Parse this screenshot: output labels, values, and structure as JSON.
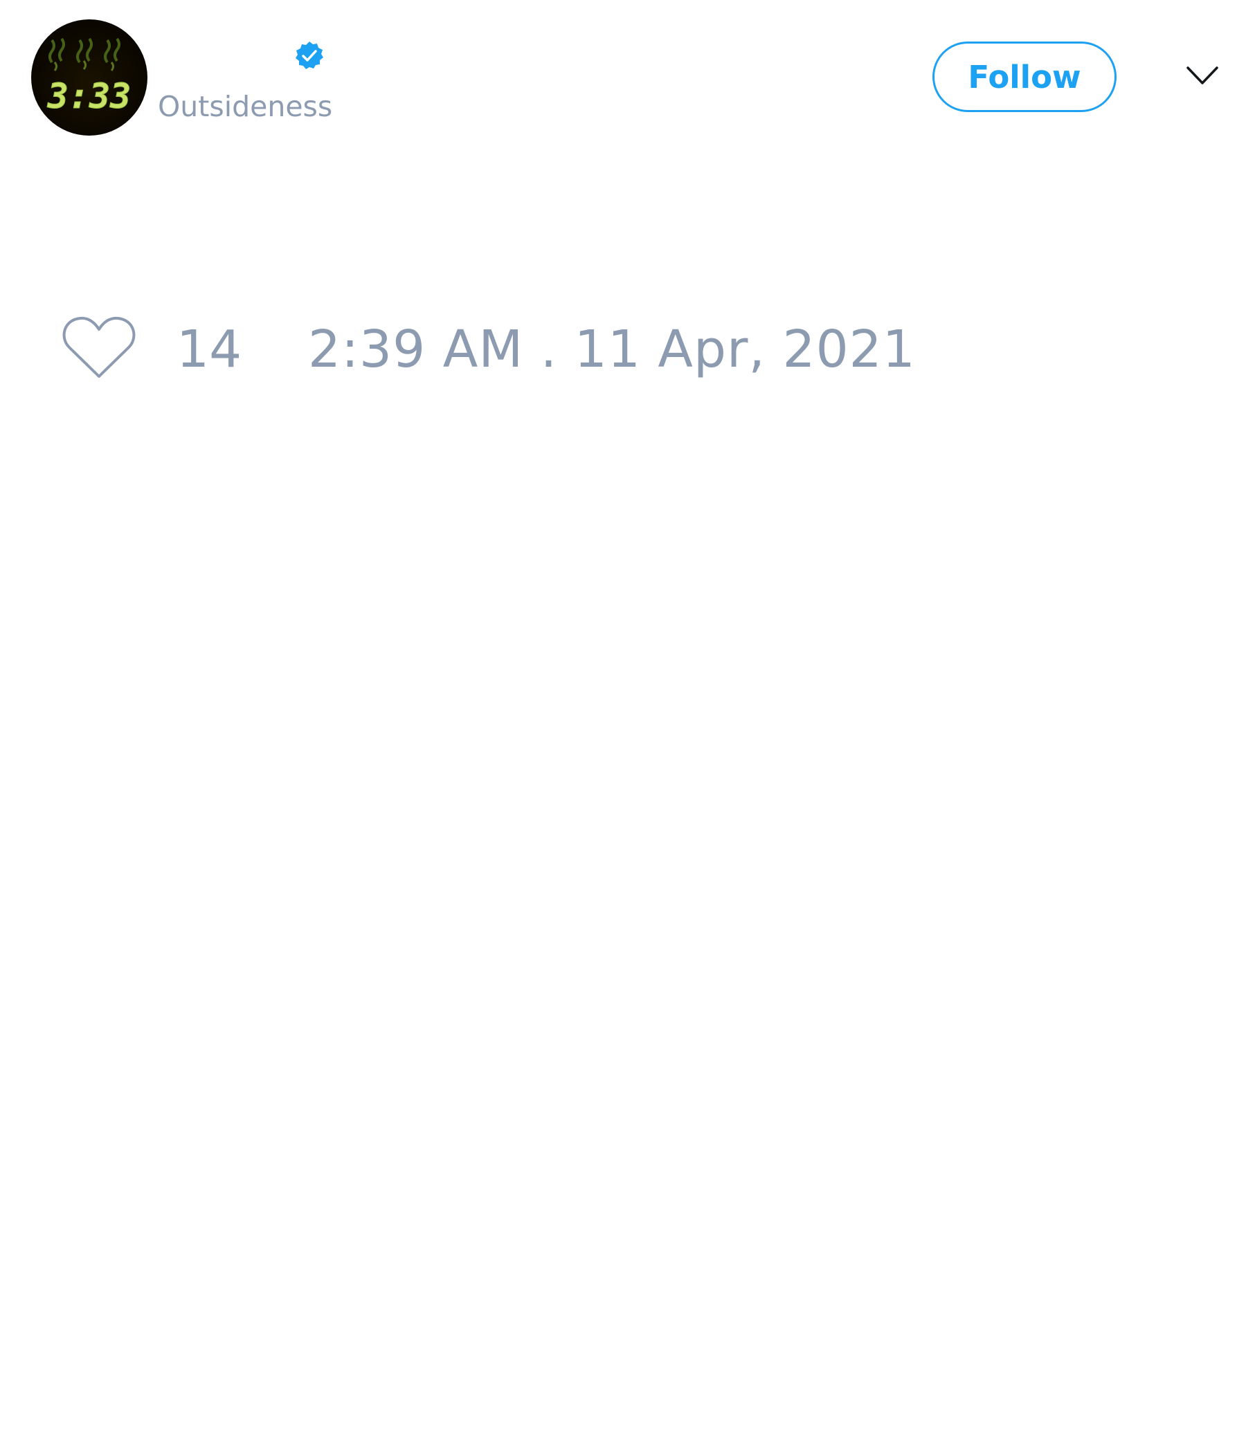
{
  "header": {
    "avatar_clock_text": "3:33",
    "handle": "Outsideness",
    "verified": true,
    "follow_label": "Follow",
    "menu_icon": "chevron-down-icon"
  },
  "tweet": {
    "like_icon": "heart-icon",
    "like_count": "14",
    "timestamp": "2:39 AM . 11 Apr, 2021"
  },
  "colors": {
    "accent": "#1da1f2",
    "muted_text": "#8c9bb0",
    "background": "#ffffff"
  }
}
